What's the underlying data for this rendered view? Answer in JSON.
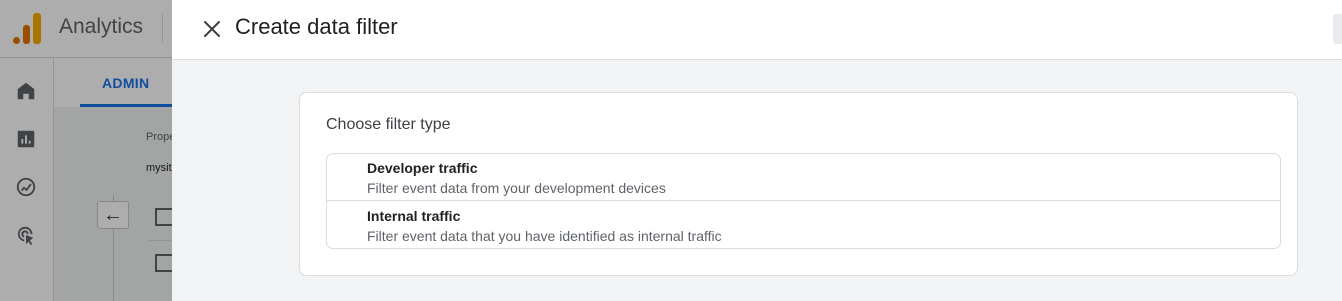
{
  "app": {
    "title": "Analytics",
    "admin_tab": "ADMIN",
    "property_label": "Prope",
    "property_value": "mysit"
  },
  "panel": {
    "title": "Create data filter",
    "card_title": "Choose filter type",
    "options": [
      {
        "title": "Developer traffic",
        "description": "Filter event data from your development devices"
      },
      {
        "title": "Internal traffic",
        "description": "Filter event data that you have identified as internal traffic"
      }
    ]
  },
  "icons": {
    "rail": [
      "home-icon",
      "reports-icon",
      "explore-icon",
      "advertising-icon"
    ],
    "close": "close-icon",
    "back": "arrow-left-icon"
  },
  "colors": {
    "accent": "#1a73e8",
    "logo_orange": "#e37400",
    "logo_yellow": "#f9ab00"
  }
}
